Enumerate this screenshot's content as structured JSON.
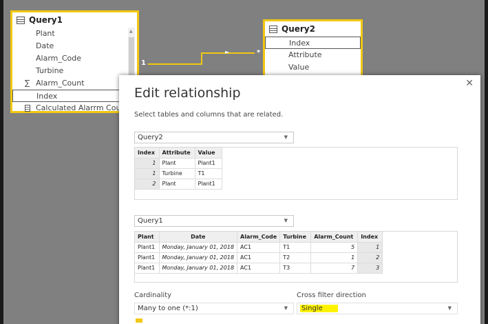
{
  "query1": {
    "title": "Query1",
    "fields": [
      {
        "label": "Plant",
        "icon": "none"
      },
      {
        "label": "Date",
        "icon": "none"
      },
      {
        "label": "Alarm_Code",
        "icon": "none"
      },
      {
        "label": "Turbine",
        "icon": "none"
      },
      {
        "label": "Alarm_Count",
        "icon": "sigma"
      },
      {
        "label": "Index",
        "icon": "none"
      },
      {
        "label": "Calculated Alarrm Count",
        "icon": "calculator"
      }
    ],
    "selected_index": 5
  },
  "query2": {
    "title": "Query2",
    "fields": [
      {
        "label": "Index"
      },
      {
        "label": "Attribute"
      },
      {
        "label": "Value"
      }
    ],
    "selected_index": 0
  },
  "relationship": {
    "from_cardinality": "1",
    "to_cardinality": "*"
  },
  "dialog": {
    "title": "Edit relationship",
    "subtitle": "Select tables and columns that are related.",
    "close_glyph": "✕",
    "table_top": {
      "selected": "Query2",
      "columns": [
        "Index",
        "Attribute",
        "Value"
      ],
      "rows": [
        [
          "1",
          "Plant",
          "Plant1"
        ],
        [
          "1",
          "Turbine",
          "T1"
        ],
        [
          "2",
          "Plant",
          "Plant1"
        ]
      ]
    },
    "table_bottom": {
      "selected": "Query1",
      "columns": [
        "Plant",
        "Date",
        "Alarm_Code",
        "Turbine",
        "Alarm_Count",
        "Index"
      ],
      "rows": [
        [
          "Plant1",
          "Monday, January 01, 2018",
          "AC1",
          "T1",
          "5",
          "1"
        ],
        [
          "Plant1",
          "Monday, January 01, 2018",
          "AC1",
          "T2",
          "1",
          "2"
        ],
        [
          "Plant1",
          "Monday, January 01, 2018",
          "AC1",
          "T3",
          "7",
          "3"
        ]
      ]
    },
    "cardinality": {
      "label": "Cardinality",
      "value": "Many to one (*:1)"
    },
    "cross_filter": {
      "label": "Cross filter direction",
      "value": "Single"
    }
  },
  "colors": {
    "accent": "#f2c811",
    "highlight": "#fff200",
    "canvas": "#808080"
  }
}
